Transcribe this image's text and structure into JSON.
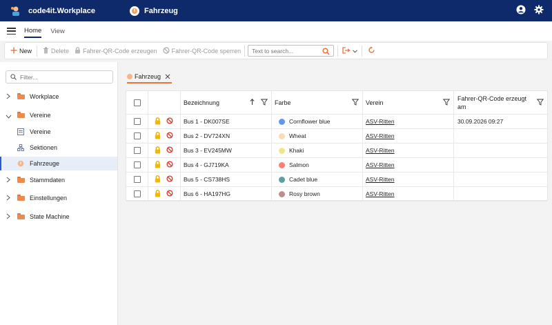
{
  "app": {
    "name": "code4it.Workplace",
    "module": "Fahrzeug"
  },
  "menu": {
    "tabs": [
      "Home",
      "View"
    ]
  },
  "toolbar": {
    "new_label": "New",
    "delete_label": "Delete",
    "generate_qr_label": "Fahrer-QR-Code erzeugen",
    "block_qr_label": "Fahrer-QR-Code sperren",
    "search_placeholder": "Text to search..."
  },
  "sidebar": {
    "filter_placeholder": "Filter...",
    "items": [
      {
        "label": "Workplace"
      },
      {
        "label": "Vereine"
      },
      {
        "label": "Vereine"
      },
      {
        "label": "Sektionen"
      },
      {
        "label": "Fahrzeuge"
      },
      {
        "label": "Stammdaten"
      },
      {
        "label": "Einstellungen"
      },
      {
        "label": "State Machine"
      }
    ]
  },
  "doc_tab": {
    "label": "Fahrzeug"
  },
  "grid": {
    "columns": [
      "Bezeichnung",
      "Farbe",
      "Verein",
      "Fahrer-QR-Code erzeugt am"
    ],
    "rows": [
      {
        "name": "Bus 1 - DK007SE",
        "color_name": "Cornflower blue",
        "color": "#6495ed",
        "verein": "ASV-Ritten",
        "qr": "30.09.2026 09:27"
      },
      {
        "name": "Bus 2 - DV724XN",
        "color_name": "Wheat",
        "color": "#f5deb3",
        "verein": "ASV-Ritten",
        "qr": ""
      },
      {
        "name": "Bus 3 - EV245MW",
        "color_name": "Khaki",
        "color": "#f0e68c",
        "verein": "ASV-Ritten",
        "qr": ""
      },
      {
        "name": "Bus 4 - GJ719KA",
        "color_name": "Salmon",
        "color": "#fa8072",
        "verein": "ASV-Ritten",
        "qr": ""
      },
      {
        "name": "Bus 5 - CS738HS",
        "color_name": "Cadet blue",
        "color": "#5f9ea0",
        "verein": "ASV-Ritten",
        "qr": ""
      },
      {
        "name": "Bus 6 - HA197HG",
        "color_name": "Rosy brown",
        "color": "#bc8f8f",
        "verein": "ASV-Ritten",
        "qr": ""
      }
    ]
  },
  "colors": {
    "topbar": "#0f2a6b",
    "accent": "#e8743b",
    "selection": "#e8eef8"
  }
}
